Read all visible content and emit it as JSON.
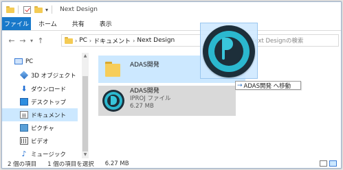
{
  "window": {
    "title": "Next Design"
  },
  "ribbon": {
    "tabs": [
      "ファイル",
      "ホーム",
      "共有",
      "表示"
    ]
  },
  "address": {
    "crumbs": [
      "PC",
      "ドキュメント",
      "Next Design"
    ],
    "search_placeholder": "Next Designの検索"
  },
  "sidebar": {
    "items": [
      {
        "label": "PC",
        "icon": "pc-icon"
      },
      {
        "label": "3D オブジェクト",
        "icon": "3d-objects-icon"
      },
      {
        "label": "ダウンロード",
        "icon": "download-icon"
      },
      {
        "label": "デスクトップ",
        "icon": "desktop-icon"
      },
      {
        "label": "ドキュメント",
        "icon": "documents-icon"
      },
      {
        "label": "ピクチャ",
        "icon": "pictures-icon"
      },
      {
        "label": "ビデオ",
        "icon": "videos-icon"
      },
      {
        "label": "ミュージック",
        "icon": "music-icon"
      }
    ]
  },
  "files": [
    {
      "name": "ADAS開発",
      "type": "folder"
    },
    {
      "name": "ADAS開発",
      "type_label": "IPROJ ファイル",
      "size": "6.27 MB"
    }
  ],
  "drag": {
    "hint": "ADAS開発 へ移動",
    "arrow": "→"
  },
  "status": {
    "count": "2 個の項目",
    "selected": "1 個の項目を選択",
    "size": "6.27 MB"
  },
  "colors": {
    "accent": "#1979ca",
    "selection": "#cce8ff",
    "logo_teal": "#2bb8cf"
  }
}
